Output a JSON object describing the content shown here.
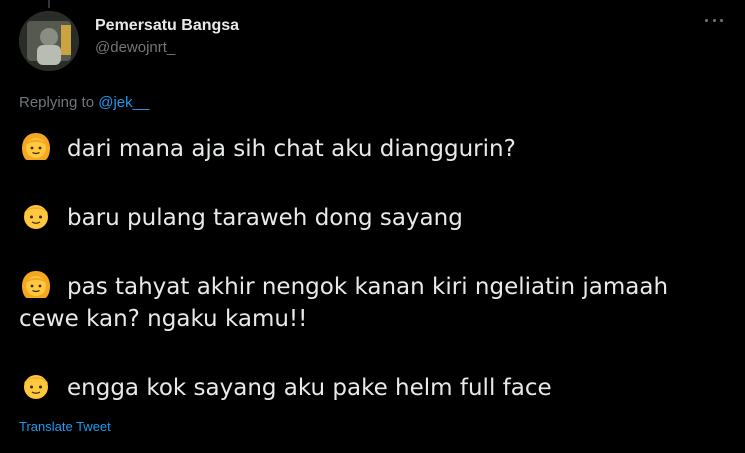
{
  "user": {
    "display_name": "Pemersatu Bangsa",
    "handle": "@dewojnrt_"
  },
  "reply": {
    "prefix": "Replying to ",
    "mention": "@jek__"
  },
  "messages": [
    {
      "speaker_icon": "girl-emoji-icon",
      "text": "dari mana aja sih chat aku dianggurin?"
    },
    {
      "speaker_icon": "boy-emoji-icon",
      "text": "baru pulang taraweh dong sayang"
    },
    {
      "speaker_icon": "girl-emoji-icon",
      "text": "pas tahyat akhir nengok kanan kiri ngeliatin jamaah",
      "text_cont": "cewe kan? ngaku kamu!!"
    },
    {
      "speaker_icon": "boy-emoji-icon",
      "text": "engga kok sayang aku pake helm full face"
    }
  ],
  "translate_label": "Translate Tweet",
  "colors": {
    "background": "#000000",
    "text": "#e7e9ea",
    "muted": "#71767b",
    "link": "#1d9bf0",
    "emoji_skin": "#ffc83d",
    "emoji_hair": "#f5a623"
  }
}
